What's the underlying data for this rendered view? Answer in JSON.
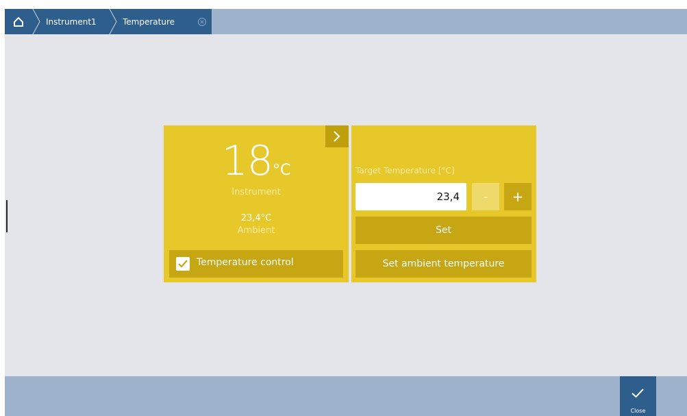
{
  "breadcrumb": {
    "home_icon": "home-icon",
    "items": [
      {
        "label": "Instrument1"
      },
      {
        "label": "Temperature"
      }
    ]
  },
  "left_panel": {
    "instrument_value": "18",
    "instrument_unit": "°C",
    "instrument_label": "Instrument",
    "ambient_value": "23,4°C",
    "ambient_label": "Ambient",
    "temperature_control_label": "Temperature control",
    "temperature_control_checked": true
  },
  "right_panel": {
    "target_label": "Target Temperature [°C]",
    "target_value": "23,4",
    "minus_label": "-",
    "plus_label": "+",
    "set_label": "Set",
    "set_ambient_label": "Set ambient temperature"
  },
  "footer": {
    "close_label": "Close"
  },
  "colors": {
    "nav": "#2e5e8c",
    "bar": "#9eb2cb",
    "panel": "#e6c82a",
    "button": "#c7a614"
  }
}
